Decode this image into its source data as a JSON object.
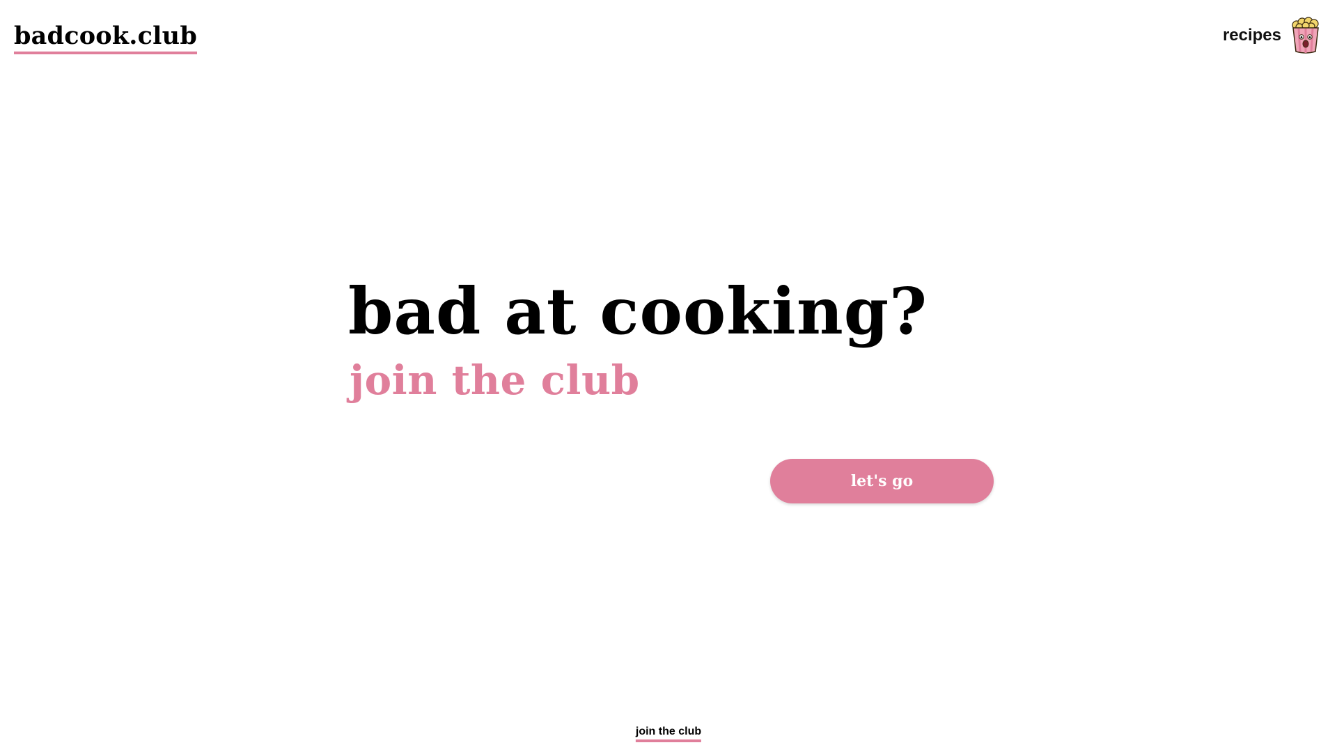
{
  "header": {
    "logo_text": "badcook.club",
    "nav": {
      "recipes_label": "recipes",
      "mascot_icon": "popcorn-bucket-icon"
    }
  },
  "hero": {
    "title": "bad at cooking?",
    "subtitle": "join the club",
    "cta_label": "let's go"
  },
  "footer": {
    "link_label": "join the club"
  },
  "colors": {
    "accent_pink": "#e07f9b",
    "text_black": "#000000",
    "background": "#ffffff"
  }
}
